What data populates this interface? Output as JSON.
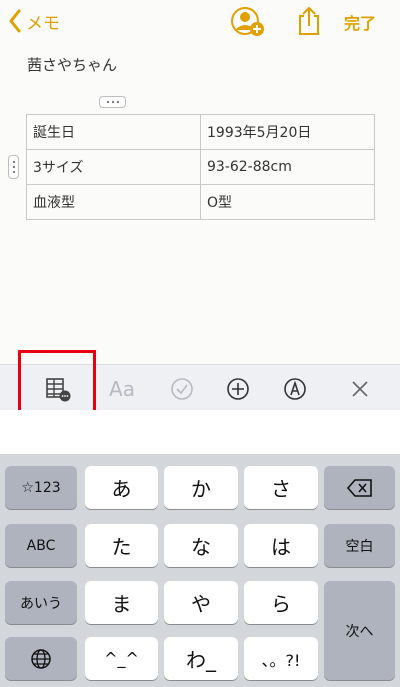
{
  "nav": {
    "back_label": "メモ",
    "done_label": "完了"
  },
  "note": {
    "title": "茜さやちゃん",
    "table": [
      [
        "誕生日",
        "1993年5月20日"
      ],
      [
        "3サイズ",
        "93-62-88cm"
      ],
      [
        "血液型",
        "O型"
      ]
    ]
  },
  "toolbar": {
    "format_label": "Aa"
  },
  "keyboard": {
    "symbols": "☆123",
    "abc": "ABC",
    "aiueo": "あいう",
    "space": "空白",
    "next": "次へ",
    "keys": [
      "あ",
      "か",
      "さ",
      "た",
      "な",
      "は",
      "ま",
      "や",
      "ら",
      "^_^",
      "わ_",
      "、。?!"
    ]
  }
}
